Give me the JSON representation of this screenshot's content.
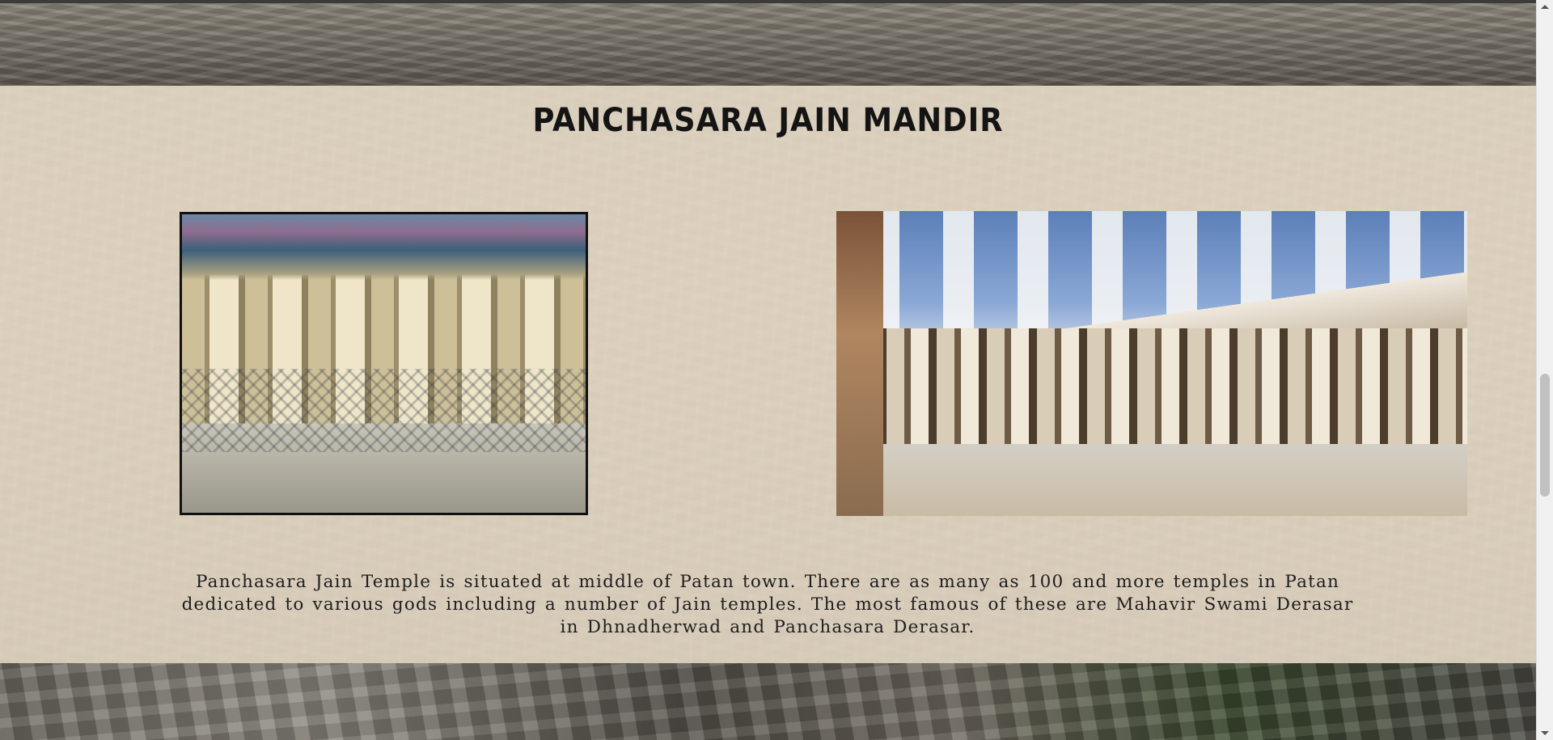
{
  "section": {
    "title": "PANCHASARA JAIN MANDIR",
    "description": "Panchasara Jain Temple is situated at middle of Patan town. There are as many as 100 and more temples in Patan dedicated to various gods including a number of Jain temples. The most famous of these are Mahavir Swami Derasar in Dhnadherwad and Panchasara Derasar."
  },
  "images": [
    {
      "subject": "temple-interior-photo"
    },
    {
      "subject": "temple-exterior-photo"
    }
  ],
  "scrollbar": {
    "position_fraction": 0.55,
    "icons": {
      "up": "arrow-up-icon",
      "down": "arrow-down-icon"
    }
  },
  "colors": {
    "panel": "#ece0cc",
    "title": "#141414",
    "text": "#1e1e1e"
  }
}
